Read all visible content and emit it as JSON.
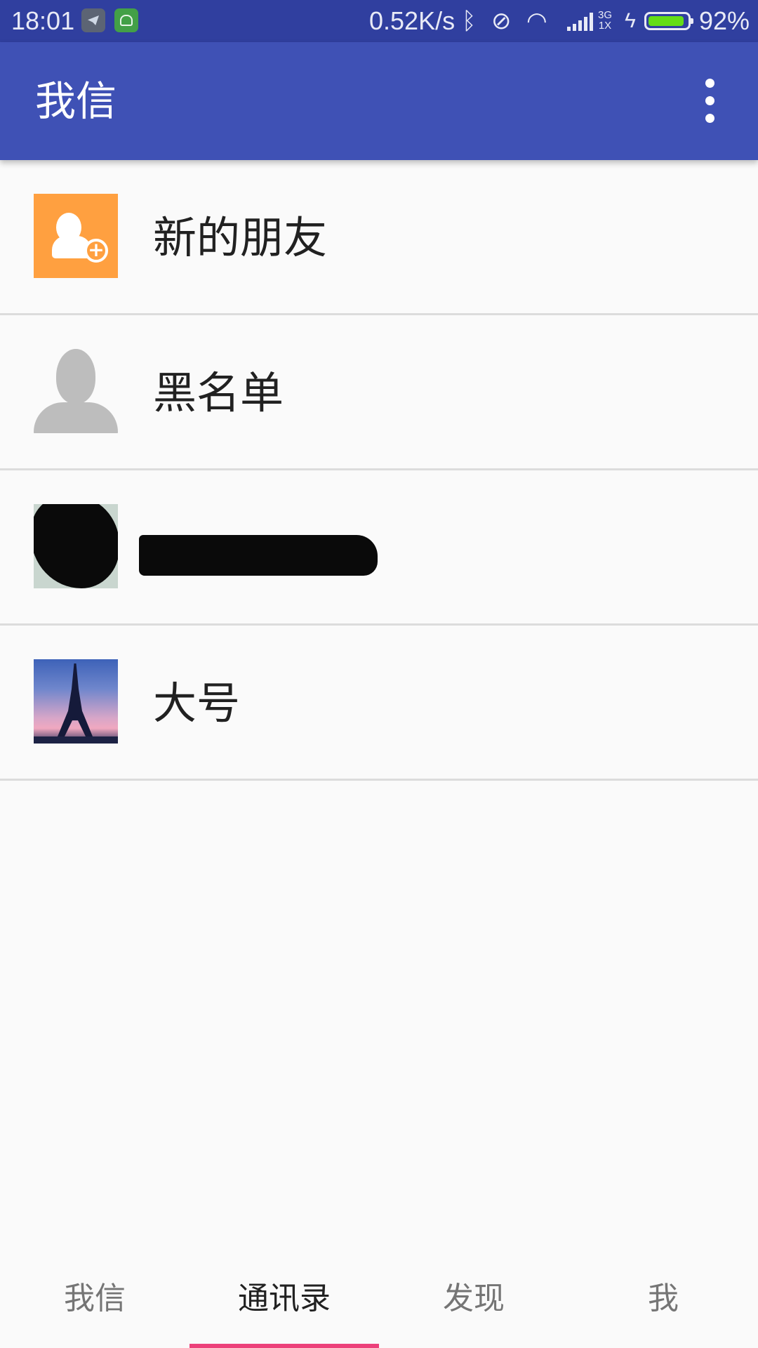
{
  "status_bar": {
    "time": "18:01",
    "net_speed": "0.52K/s",
    "network_type_top": "3G",
    "network_type_bottom": "1X",
    "battery_percent_text": "92%",
    "battery_level": 0.92
  },
  "app_bar": {
    "title": "我信",
    "color": "#3f51b5"
  },
  "contacts": [
    {
      "name": "新的朋友",
      "avatar": "new-friend-icon"
    },
    {
      "name": "黑名单",
      "avatar": "person-icon"
    },
    {
      "name": "",
      "avatar": "redacted-photo"
    },
    {
      "name": "大号",
      "avatar": "eiffel-tower-photo"
    }
  ],
  "tabs": [
    {
      "label": "我信",
      "active": false
    },
    {
      "label": "通讯录",
      "active": true
    },
    {
      "label": "发现",
      "active": false
    },
    {
      "label": "我",
      "active": false
    }
  ],
  "accent_color": "#ec407a"
}
